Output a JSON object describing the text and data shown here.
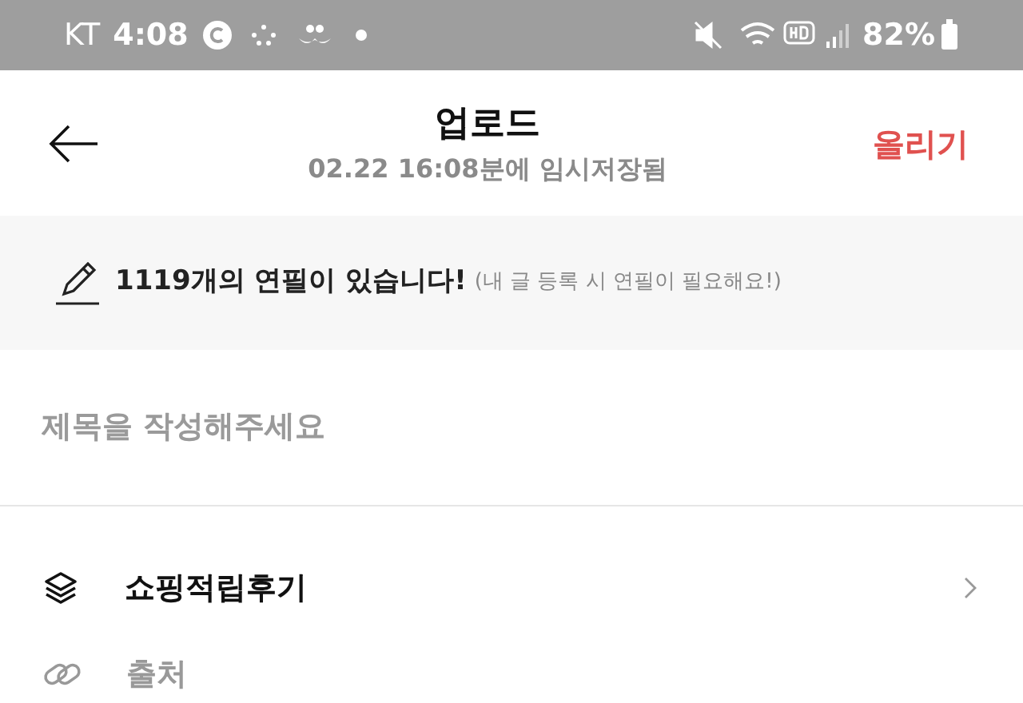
{
  "status_bar": {
    "carrier": "KT",
    "time": "4:08",
    "battery": "82%"
  },
  "header": {
    "title": "업로드",
    "subtitle": "02.22 16:08분에 임시저장됨",
    "action": "올리기"
  },
  "notice": {
    "main": "1119개의 연필이 있습니다!",
    "note": "(내 글 등록 시 연필이 필요해요!)"
  },
  "title_field": {
    "placeholder": "제목을 작성해주세요"
  },
  "options": [
    {
      "kind": "category",
      "label": "쇼핑적립후기"
    },
    {
      "kind": "source",
      "label": "출처"
    }
  ]
}
